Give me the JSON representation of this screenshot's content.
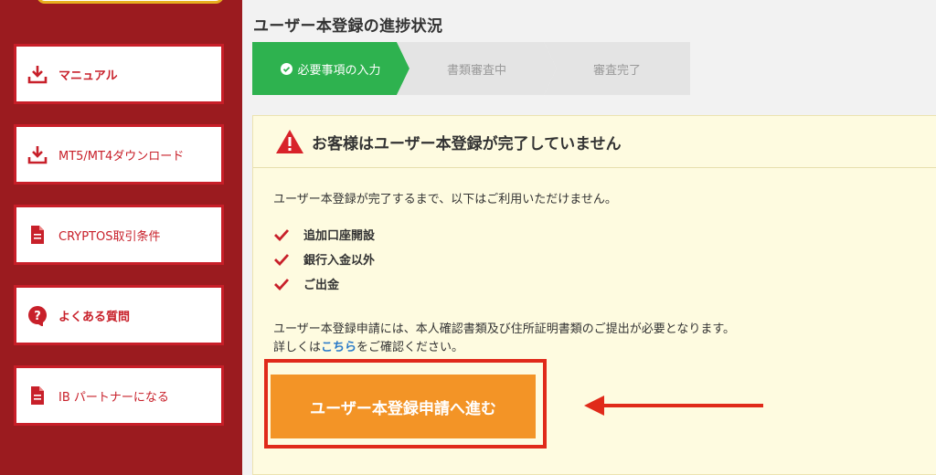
{
  "sidebar": {
    "items": [
      {
        "label": "マニュアル",
        "icon": "download-icon"
      },
      {
        "label": "MT5/MT4ダウンロード",
        "icon": "download-icon"
      },
      {
        "label": "CRYPTOS取引条件",
        "icon": "document-icon"
      },
      {
        "label": "よくある質問",
        "icon": "question-bubble-icon"
      },
      {
        "label": "IB パートナーになる",
        "icon": "document-icon"
      }
    ]
  },
  "main": {
    "title": "ユーザー本登録の進捗状況",
    "steps": [
      {
        "label": "必要事項の入力",
        "active": true
      },
      {
        "label": "書類審査中",
        "active": false
      },
      {
        "label": "審査完了",
        "active": false
      }
    ],
    "notice": {
      "title": "お客様はユーザー本登録が完了していません",
      "intro": "ユーザー本登録が完了するまで、以下はご利用いただけません。",
      "restrictions": [
        "追加口座開設",
        "銀行入金以外",
        "ご出金"
      ],
      "desc_line1": "ユーザー本登録申請には、本人確認書類及び住所証明書類のご提出が必要となります。",
      "desc_prefix": "詳しくは",
      "desc_link": "こちら",
      "desc_suffix": "をご確認ください。",
      "cta_label": "ユーザー本登録申請へ進む"
    }
  },
  "colors": {
    "sidebar_bg": "#9b1b1f",
    "accent_red": "#c8202a",
    "step_active": "#2eb24f",
    "step_inactive": "#e4e4e4",
    "cta_orange": "#f39426",
    "notice_bg": "#fefbe0",
    "highlight_red": "#e02a1a"
  }
}
